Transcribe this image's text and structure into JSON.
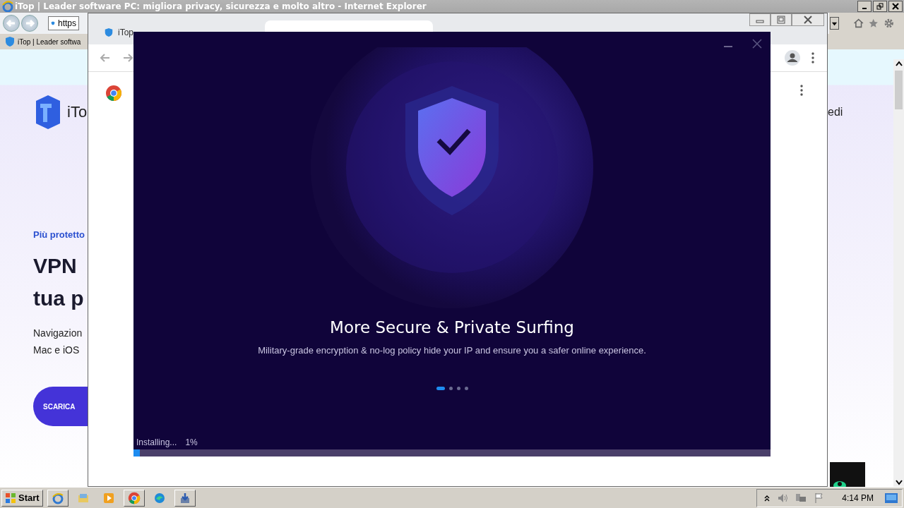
{
  "ie_window": {
    "title": "iTop | Leader software PC: migliora privacy, sicurezza e molto altro - Internet Explorer",
    "address": "https",
    "favorites_tab": "iTop | Leader softwa"
  },
  "web_page": {
    "logo_text": "iTo",
    "eyebrow": "Più protetto",
    "headline_lines": [
      "VPN",
      "tua p"
    ],
    "description_lines": [
      "Navigazion",
      "Mac e iOS"
    ],
    "button": "SCARICA",
    "side_text": "edi"
  },
  "chrome_window": {
    "tabs": [
      {
        "label": "iTop",
        "selected": false
      },
      {
        "selected": true
      }
    ]
  },
  "installer": {
    "slide_title": "More Secure & Private Surfing",
    "slide_text": "Military-grade encryption & no-log policy hide your IP and ensure you a safer online experience.",
    "slides": [
      {
        "selected": true
      },
      {
        "selected": false
      },
      {
        "selected": false
      },
      {
        "selected": false
      }
    ],
    "status": "Installing...",
    "percent": "1%",
    "level": 0.01
  },
  "taskbar": {
    "start": "Start",
    "clock": "4:14 PM"
  }
}
